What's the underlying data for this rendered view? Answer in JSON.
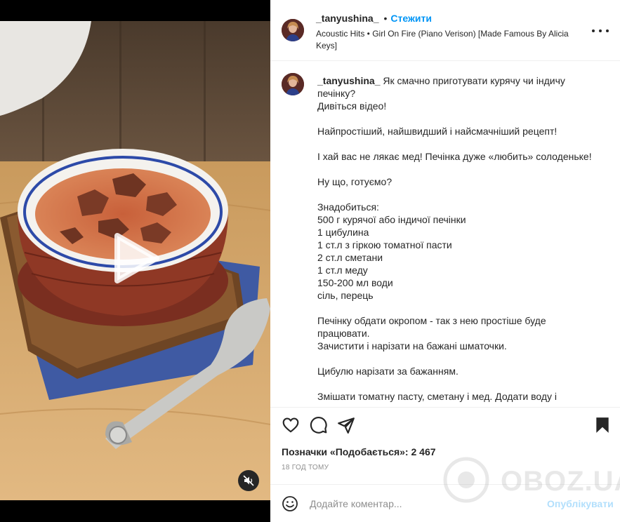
{
  "post": {
    "username": "_tanyushina_",
    "separator": "•",
    "follow_label": "Стежити",
    "music": "Acoustic Hits • Girl On Fire (Piano Verison) [Made Famous By Alicia Keys]",
    "caption_user": "_tanyushina_",
    "caption_text": " Як смачно приготувати курячу чи індичу печінку?\nДивіться відео!\n\nНайпростіший, найшвидший і найсмачніший рецепт!\n\nІ хай вас не лякає мед! Печінка дуже «любить» солоденьке!\n\nНу що, готуємо?\n\nЗнадобиться:\n500 г курячої або індичої печінки\n1 цибулина\n1 ст.л з гіркою томатної пасти\n2 ст.л сметани\n1 ст.л меду\n150-200 мл води\nсіль, перець\n\nПечінку обдати окропом - так з нею простіше буде працювати.\nЗачистити і нарізати на бажані шматочки.\n\nЦибулю нарізати за бажанням.\n\nЗмішати томатну пасту, сметану і мед. Додати воду і",
    "likes_text": "Позначки «Подобається»: 2 467",
    "time_ago": "18 ГОД ТОМУ"
  },
  "comment_box": {
    "placeholder": "Додайте коментар...",
    "post_label": "Опублікувати"
  },
  "watermark": {
    "text": "OBOZ.UA"
  },
  "icons": {
    "play": "play-icon",
    "mute": "muted-speaker-icon",
    "more": "more-horizontal-icon",
    "like": "heart-icon",
    "comment": "comment-bubble-icon",
    "share": "paper-plane-icon",
    "save": "bookmark-icon",
    "emoji": "smiley-icon"
  },
  "colors": {
    "accent": "#0095f6",
    "post_disabled": "#b2dffc",
    "text": "#262626",
    "muted": "#8e8e8e"
  }
}
